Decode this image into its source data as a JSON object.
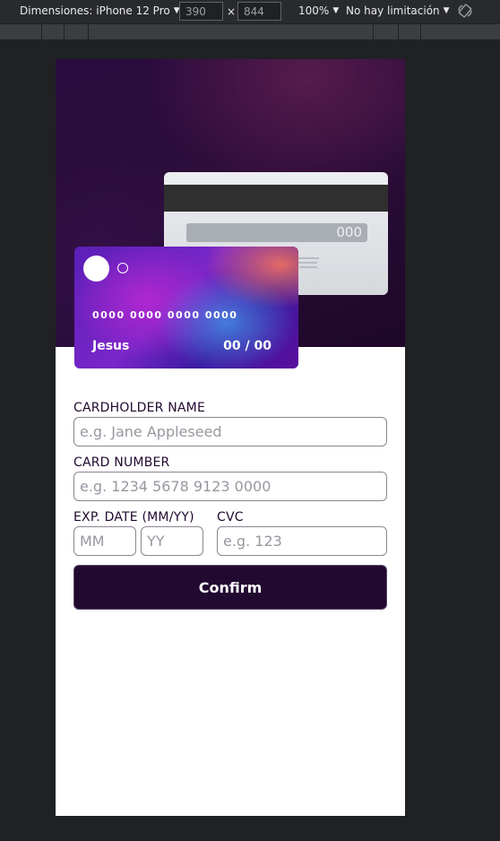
{
  "devtools": {
    "device_label": "Dimensiones: iPhone 12 Pro",
    "width_value": "390",
    "height_value": "844",
    "times_symbol": "×",
    "zoom_label": "100%",
    "throttle_label": "No hay limitación",
    "dropdown_arrow": "▼"
  },
  "card_back": {
    "cvc": "000"
  },
  "card_front": {
    "number": "0000 0000 0000 0000",
    "holder": "Jesus",
    "expiry": "00 / 00"
  },
  "form": {
    "cardholder_label": "CARDHOLDER NAME",
    "cardholder_placeholder": "e.g. Jane Appleseed",
    "number_label": "CARD NUMBER",
    "number_placeholder": "e.g. 1234 5678 9123 0000",
    "exp_label": "EXP. DATE (MM/YY)",
    "mm_placeholder": "MM",
    "yy_placeholder": "YY",
    "cvc_label": "CVC",
    "cvc_placeholder": "e.g. 123",
    "confirm_label": "Confirm"
  },
  "colors": {
    "devtools_bg": "#202124",
    "hero_dark": "#2a0b3e",
    "text_dark": "#21092f",
    "button_bg": "#21092f",
    "input_border": "#8e8593"
  }
}
